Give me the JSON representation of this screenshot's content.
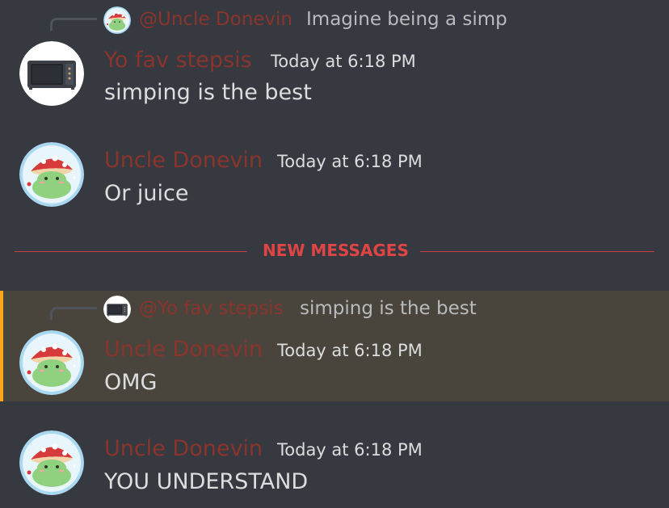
{
  "messages": [
    {
      "reply": {
        "author": "@Uncle Donevin",
        "text": "Imagine being a simp",
        "avatar_icon": "frog-mushroom-avatar"
      },
      "author": "Yo fav stepsis",
      "timestamp": "Today at 6:18 PM",
      "content": "simping is the best",
      "avatar_icon": "microwave-avatar"
    },
    {
      "author": "Uncle Donevin",
      "timestamp": "Today at 6:18 PM",
      "content": "Or juice",
      "avatar_icon": "frog-mushroom-avatar"
    },
    {
      "reply": {
        "author": "@Yo fav stepsis",
        "text": "simping is the best",
        "avatar_icon": "microwave-avatar"
      },
      "author": "Uncle Donevin",
      "timestamp": "Today at 6:18 PM",
      "content": "OMG",
      "avatar_icon": "frog-mushroom-avatar",
      "highlighted": true
    },
    {
      "author": "Uncle Donevin",
      "timestamp": "Today at 6:18 PM",
      "content": "YOU UNDERSTAND",
      "avatar_icon": "frog-mushroom-avatar"
    }
  ],
  "divider": {
    "label": "NEW MESSAGES"
  },
  "colors": {
    "background": "#36393f",
    "username": "#8a342d",
    "new_messages": "#e04545",
    "mention_highlight_bg": "#49443c",
    "mention_highlight_bar": "#faa61a"
  }
}
